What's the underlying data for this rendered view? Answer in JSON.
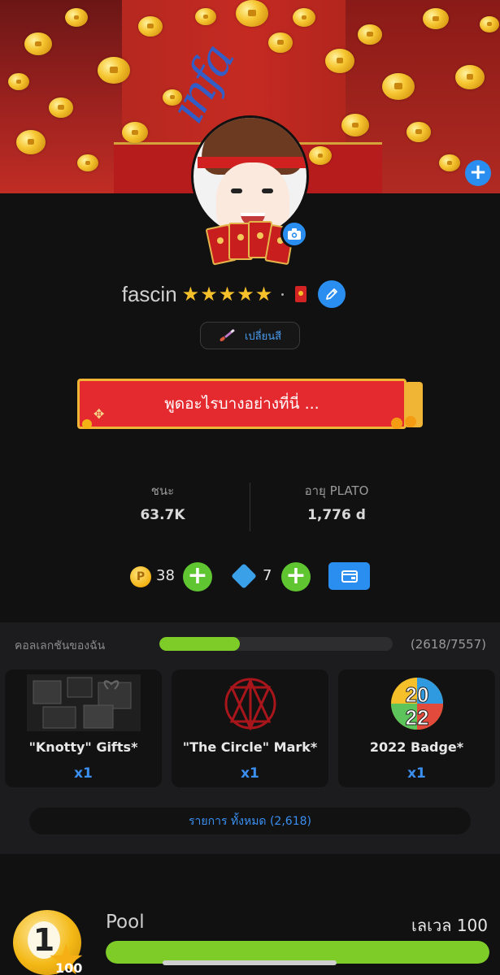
{
  "profile": {
    "name": "fascin",
    "stars": "★★★★★",
    "change_color_label": "เปลี่ยนสี",
    "status_text": "พูดอะไรบางอย่างที่นี่ ..."
  },
  "stats": {
    "wins_label": "ชนะ",
    "wins_value": "63.7K",
    "age_label": "อายุ PLATO",
    "age_value": "1,776 d"
  },
  "currency": {
    "coin_symbol": "P",
    "coins": "38",
    "gems": "7",
    "plus": "+"
  },
  "collection": {
    "title": "คอลเลกชันของฉัน",
    "count": "(2618/7557)",
    "progress": 0.3464,
    "items": [
      {
        "name": "\"Knotty\" Gifts*",
        "qty": "x1"
      },
      {
        "name": "\"The Circle\" Mark*",
        "qty": "x1"
      },
      {
        "name": "2022 Badge*",
        "qty": "x1"
      }
    ],
    "badge_top": "20",
    "badge_bottom": "22",
    "view_all": "รายการ ทั้งหมด (2,618)"
  },
  "game": {
    "ball_number": "1",
    "level_number": "100",
    "name": "Pool",
    "level_label": "เลเวล 100",
    "progress": 1.0
  },
  "colors": {
    "accent_blue": "#2a8ef0",
    "green": "#7dcc28",
    "status_red": "#e4292f",
    "gold": "#f1b535"
  }
}
